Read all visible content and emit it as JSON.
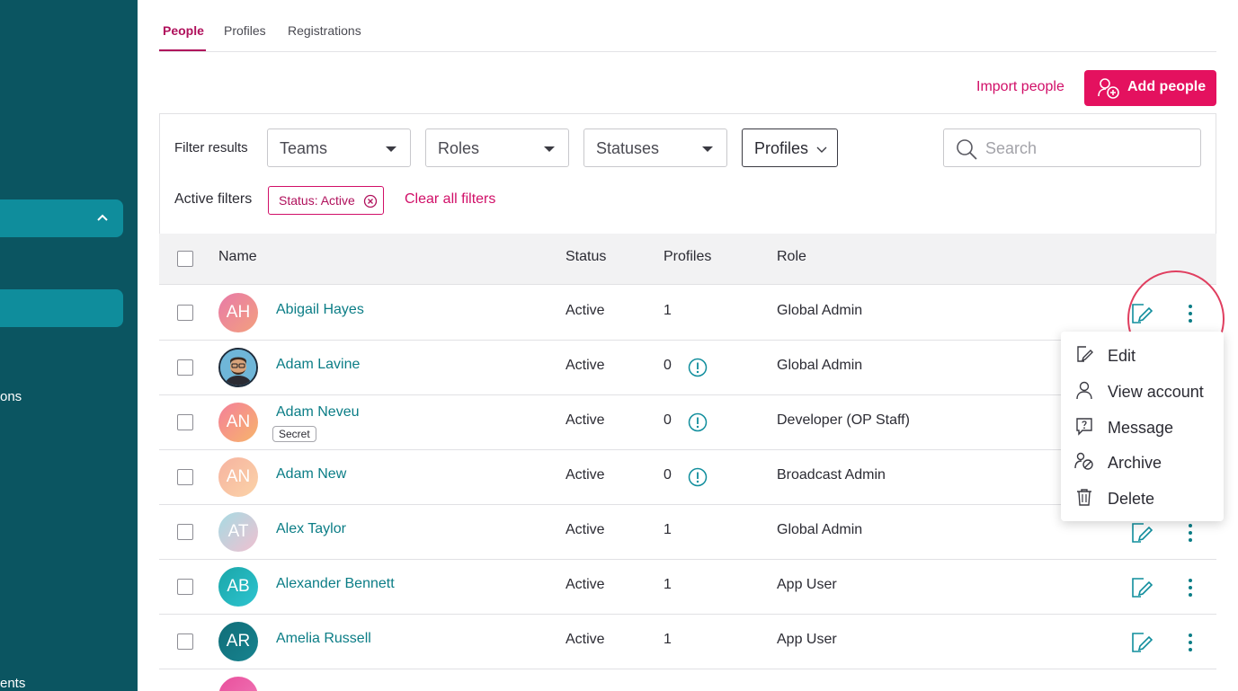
{
  "sidebar": {
    "partial_labels": [
      "ons",
      "ents"
    ]
  },
  "tabs": [
    {
      "label": "People",
      "active": true
    },
    {
      "label": "Profiles",
      "active": false
    },
    {
      "label": "Registrations",
      "active": false
    }
  ],
  "actions": {
    "import_label": "Import people",
    "add_label": "Add people"
  },
  "filters": {
    "label": "Filter results",
    "teams": "Teams",
    "roles": "Roles",
    "statuses": "Statuses",
    "profiles": "Profiles",
    "search_placeholder": "Search",
    "active_label": "Active filters",
    "chip": "Status: Active",
    "clear_label": "Clear all filters"
  },
  "table": {
    "headers": {
      "name": "Name",
      "status": "Status",
      "profiles": "Profiles",
      "role": "Role"
    },
    "rows": [
      {
        "initials": "AH",
        "name": "Abigail Hayes",
        "status": "Active",
        "profiles": "1",
        "role": "Global Admin"
      },
      {
        "initials": "",
        "name": "Adam Lavine",
        "status": "Active",
        "profiles": "0",
        "role": "Global Admin"
      },
      {
        "initials": "AN",
        "name": "Adam Neveu",
        "tag": "Secret",
        "status": "Active",
        "profiles": "0",
        "role": "Developer (OP Staff)"
      },
      {
        "initials": "AN",
        "name": "Adam New",
        "status": "Active",
        "profiles": "0",
        "role": "Broadcast Admin"
      },
      {
        "initials": "AT",
        "name": "Alex Taylor",
        "status": "Active",
        "profiles": "1",
        "role": "Global Admin"
      },
      {
        "initials": "AB",
        "name": "Alexander Bennett",
        "status": "Active",
        "profiles": "1",
        "role": "App User"
      },
      {
        "initials": "AR",
        "name": "Amelia Russell",
        "status": "Active",
        "profiles": "1",
        "role": "App User"
      }
    ]
  },
  "menu": {
    "items": [
      "Edit",
      "View account",
      "Message",
      "Archive",
      "Delete"
    ]
  },
  "colors": {
    "sidebar": "#0b5561",
    "sidebar_active": "#0f8d9c",
    "accent": "#e4115f",
    "link": "#0b7d86"
  }
}
